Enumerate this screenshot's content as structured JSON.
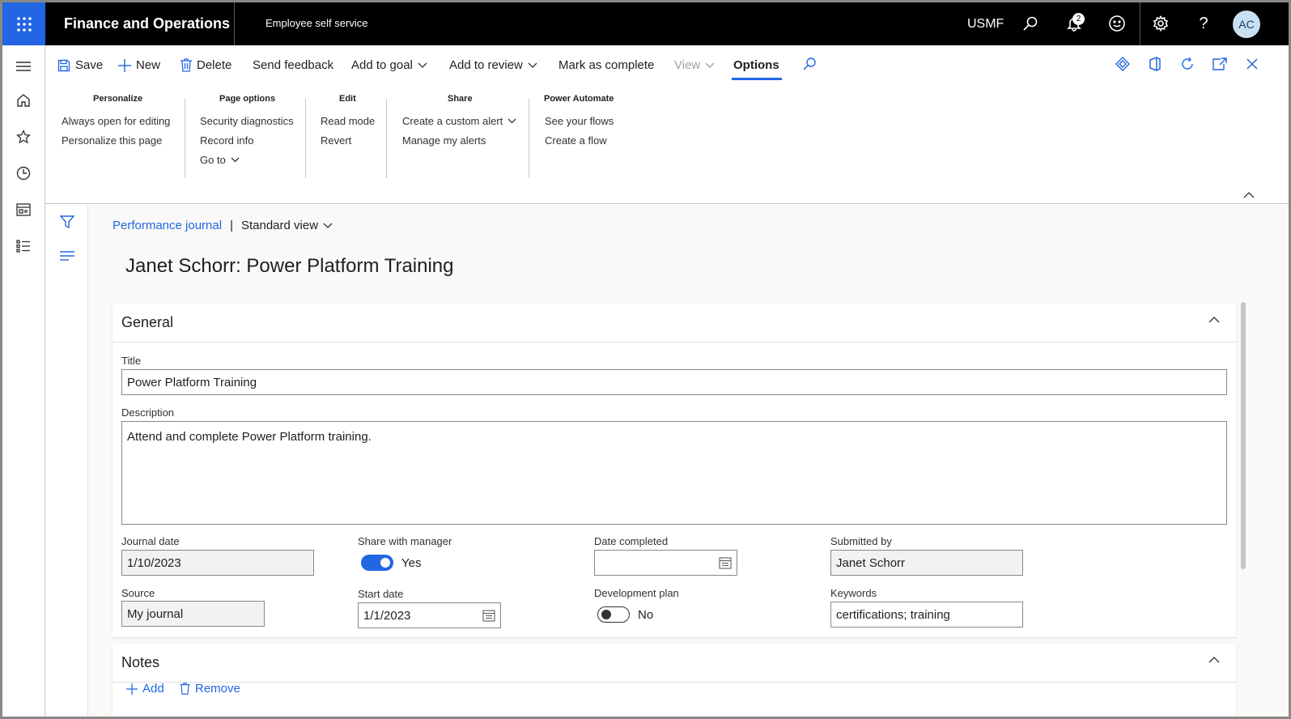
{
  "topbar": {
    "app_title": "Finance and Operations",
    "module": "Employee self service",
    "company": "USMF",
    "notification_count": "2",
    "avatar_initials": "AC"
  },
  "actions": {
    "save": "Save",
    "new": "New",
    "delete": "Delete",
    "send_feedback": "Send feedback",
    "add_to_goal": "Add to goal",
    "add_to_review": "Add to review",
    "mark_complete": "Mark as complete",
    "view": "View",
    "options": "Options"
  },
  "groups": {
    "personalize": {
      "title": "Personalize",
      "items": [
        "Always open for editing",
        "Personalize this page"
      ]
    },
    "page_options": {
      "title": "Page options",
      "items": [
        "Security diagnostics",
        "Record info",
        "Go to"
      ]
    },
    "edit": {
      "title": "Edit",
      "items": [
        "Read mode",
        "Revert"
      ]
    },
    "share": {
      "title": "Share",
      "items": [
        "Create a custom alert",
        "Manage my alerts"
      ]
    },
    "power_automate": {
      "title": "Power Automate",
      "items": [
        "See your flows",
        "Create a flow"
      ]
    }
  },
  "breadcrumb": {
    "link": "Performance journal",
    "separator": "|",
    "view": "Standard view"
  },
  "page_title": "Janet Schorr: Power Platform Training",
  "general": {
    "header": "General",
    "title_label": "Title",
    "title_value": "Power Platform Training",
    "description_label": "Description",
    "description_value": "Attend and complete Power Platform training.",
    "journal_date_label": "Journal date",
    "journal_date_value": "1/10/2023",
    "share_label": "Share with manager",
    "share_value": "Yes",
    "date_completed_label": "Date completed",
    "date_completed_value": "",
    "submitted_by_label": "Submitted by",
    "submitted_by_value": "Janet Schorr",
    "source_label": "Source",
    "source_value": "My journal",
    "start_date_label": "Start date",
    "start_date_value": "1/1/2023",
    "dev_plan_label": "Development plan",
    "dev_plan_value": "No",
    "keywords_label": "Keywords",
    "keywords_value": "certifications; training"
  },
  "notes": {
    "header": "Notes",
    "add": "Add",
    "remove": "Remove"
  },
  "colors": {
    "accent": "#2266e3",
    "topbar": "#000000"
  }
}
